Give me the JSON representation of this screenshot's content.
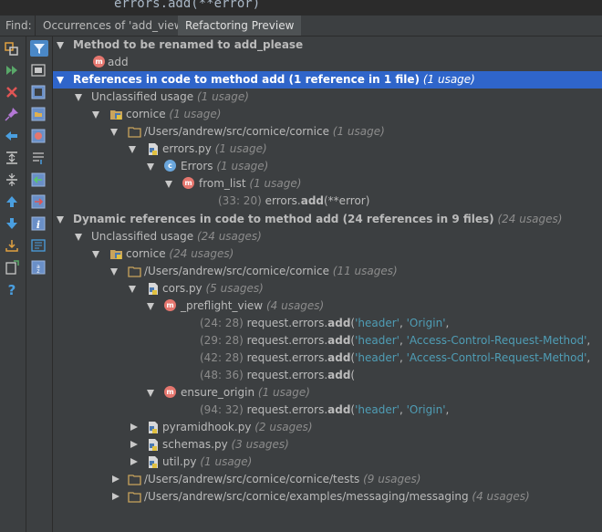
{
  "editor_peek": {
    "code": "errors.add(**error)"
  },
  "find_bar": {
    "label": "Find:",
    "tabs": [
      {
        "label": "Occurrences of 'add_view'",
        "active": false
      },
      {
        "label": "Refactoring Preview",
        "active": true
      }
    ]
  },
  "left_toolbar": {
    "icons": [
      "rerun-icon",
      "next-occurrence-icon",
      "close-icon",
      "pin-icon",
      "previous-icon",
      "expand-all-icon",
      "collapse-all-icon",
      "up-icon",
      "down-icon",
      "export-icon",
      "open-in-window-icon",
      "help-icon"
    ]
  },
  "mid_toolbar": {
    "icons": [
      "filter-icon",
      "group-by-type-icon",
      "group-by-module-icon",
      "group-by-directory-icon",
      "group-by-file-icon",
      "merge-icon",
      "navigate-import-icon",
      "navigate-export-icon",
      "info-icon",
      "preview-icon",
      "sort-az-icon"
    ]
  },
  "tree": {
    "method_header": "Method to be renamed to add_please",
    "method_name": "add",
    "refs": {
      "label": "References in code to method add (1 reference in 1 file)",
      "count": "(1 usage)",
      "group": {
        "label": "Unclassified usage",
        "count": "(1 usage)"
      },
      "module": {
        "label": "cornice",
        "count": "(1 usage)"
      },
      "dir": {
        "label": "/Users/andrew/src/cornice/cornice",
        "count": "(1 usage)"
      },
      "file": {
        "label": "errors.py",
        "count": "(1 usage)"
      },
      "cls": {
        "label": "Errors",
        "count": "(1 usage)"
      },
      "func": {
        "label": "from_list",
        "count": "(1 usage)"
      },
      "usage": {
        "loc": "(33: 20)",
        "pre": "errors.",
        "hit": "add",
        "post": "(**error)"
      }
    },
    "dyn": {
      "label": "Dynamic references in code to method add (24 references in 9 files)",
      "count": "(24 usages)",
      "group": {
        "label": "Unclassified usage",
        "count": "(24 usages)"
      },
      "module": {
        "label": "cornice",
        "count": "(24 usages)"
      },
      "dir": {
        "label": "/Users/andrew/src/cornice/cornice",
        "count": "(11 usages)"
      },
      "file": {
        "label": "cors.py",
        "count": "(5 usages)"
      },
      "func1": {
        "label": "_preflight_view",
        "count": "(4 usages)"
      },
      "usages1": [
        {
          "loc": "(24: 28)",
          "pre": "request.errors.",
          "hit": "add",
          "p1": "(",
          "s1": "'header'",
          "p2": ", ",
          "s2": "'Origin'",
          "p3": ","
        },
        {
          "loc": "(29: 28)",
          "pre": "request.errors.",
          "hit": "add",
          "p1": "(",
          "s1": "'header'",
          "p2": ", ",
          "s2": "'Access-Control-Request-Method'",
          "p3": ","
        },
        {
          "loc": "(42: 28)",
          "pre": "request.errors.",
          "hit": "add",
          "p1": "(",
          "s1": "'header'",
          "p2": ", ",
          "s2": "'Access-Control-Request-Method'",
          "p3": ","
        },
        {
          "loc": "(48: 36)",
          "pre": "request.errors.",
          "hit": "add",
          "p1": "(",
          "s1": "",
          "p2": "",
          "s2": "",
          "p3": ""
        }
      ],
      "func2": {
        "label": "ensure_origin",
        "count": "(1 usage)"
      },
      "usage2": {
        "loc": "(94: 32)",
        "pre": "request.errors.",
        "hit": "add",
        "p1": "(",
        "s1": "'header'",
        "p2": ", ",
        "s2": "'Origin'",
        "p3": ","
      },
      "files": [
        {
          "label": "pyramidhook.py",
          "count": "(2 usages)"
        },
        {
          "label": "schemas.py",
          "count": "(3 usages)"
        },
        {
          "label": "util.py",
          "count": "(1 usage)"
        }
      ],
      "dirs": [
        {
          "label": "/Users/andrew/src/cornice/cornice/tests",
          "count": "(9 usages)"
        },
        {
          "label": "/Users/andrew/src/cornice/examples/messaging/messaging",
          "count": "(4 usages)"
        }
      ]
    }
  },
  "colors": {
    "selection": "#2f65ca",
    "method_badge": "#e5766e",
    "class_badge": "#6aa6dc",
    "string_literal": "#4f9db5"
  }
}
